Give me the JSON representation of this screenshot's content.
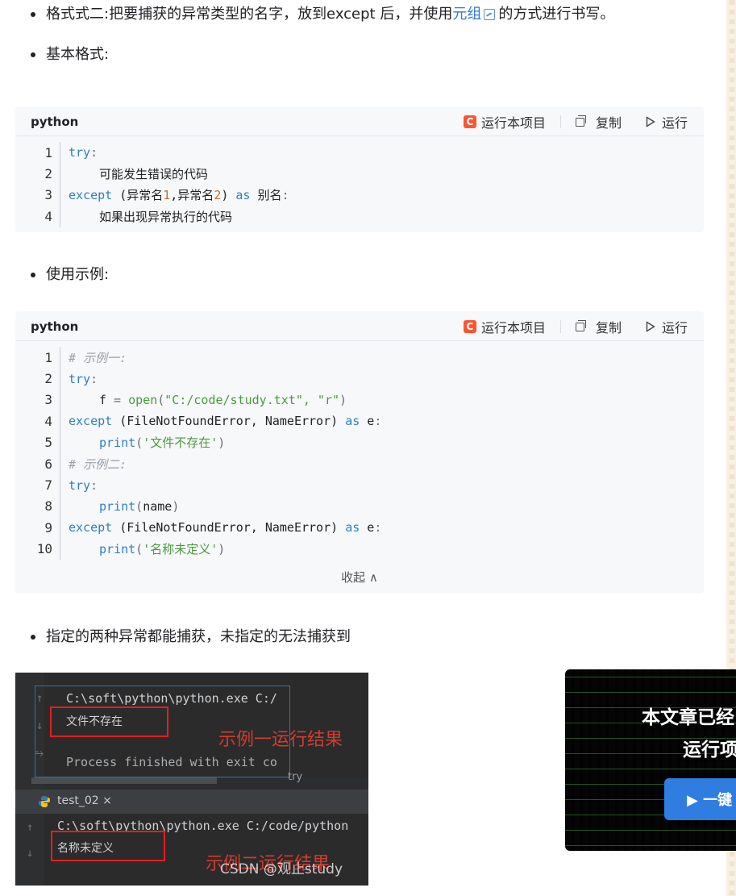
{
  "bullets": {
    "format2_prefix": "格式式二:把要捕获的异常类型的名字，放到except 后，并使用",
    "format2_link": "元组",
    "format2_suffix": "的方式进行书写。",
    "basic_format": "基本格式:",
    "usage_example": "使用示例:",
    "conclusion": "指定的两种异常都能捕获，未指定的无法捕获到"
  },
  "code_toolbar": {
    "language": "python",
    "run_project": "运行本项目",
    "copy": "复制",
    "run": "运行",
    "c_logo": "C"
  },
  "code_block_1": {
    "line_numbers": [
      "1",
      "2",
      "3",
      "4"
    ],
    "lines": [
      {
        "kw": "try",
        "op": ":"
      },
      {
        "text": "可能发生错误的代码"
      },
      {
        "kw": "except",
        "a": " (异常名",
        "n1": "1",
        "b": ",异常名",
        "n2": "2",
        "c": ") ",
        "kw2": "as",
        "d": " 别名",
        "op": ":"
      },
      {
        "text": "如果出现异常执行的代码"
      }
    ]
  },
  "code_block_2": {
    "line_numbers": [
      "1",
      "2",
      "3",
      "4",
      "5",
      "6",
      "7",
      "8",
      "9",
      "10"
    ],
    "line1_comment": "# 示例一:",
    "line2_kw": "try",
    "line3_var": "f",
    "line3_eq": " = ",
    "line3_fn": "open",
    "line3_args": "\"C:/code/study.txt\", \"r\"",
    "line4_kw": "except",
    "line4_exc": "(FileNotFoundError, NameError)",
    "line4_as": "as",
    "line4_alias": "e",
    "line5_fn": "print",
    "line5_str": "'文件不存在'",
    "line6_comment": "# 示例二:",
    "line7_kw": "try",
    "line8_fn": "print",
    "line8_arg": "name",
    "line9_kw": "except",
    "line9_exc": "(FileNotFoundError, NameError)",
    "line9_as": "as",
    "line9_alias": "e",
    "line10_fn": "print",
    "line10_str": "'名称未定义'",
    "collapse": "收起 ∧"
  },
  "screenshot": {
    "cmd1": "C:\\soft\\python\\python.exe C:/",
    "out1": "文件不存在",
    "label1": "示例一运行结果",
    "finished": "Process finished with exit co",
    "try_tag": "try",
    "tab": "test_02 ×",
    "cmd2": "C:\\soft\\python\\python.exe C:/code/python",
    "out2": "名称未定义",
    "label2": "示例二运行结果",
    "watermark": "CSDN @观止study"
  },
  "ad": {
    "title": "本文章已经",
    "subtitle": "运行项",
    "button": "▶ 一键"
  }
}
